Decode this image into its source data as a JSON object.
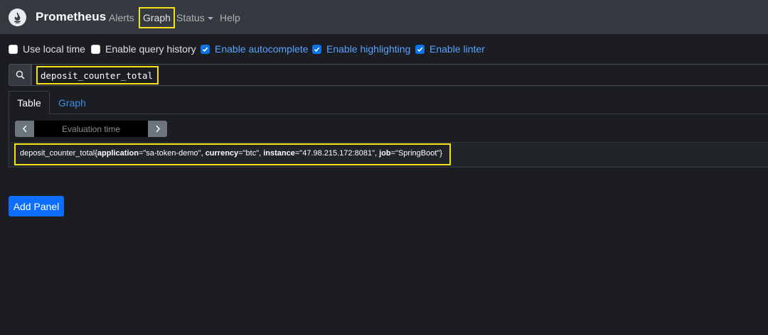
{
  "navbar": {
    "brand": "Prometheus",
    "links": {
      "alerts": "Alerts",
      "graph": "Graph",
      "status": "Status",
      "help": "Help"
    }
  },
  "options": {
    "local_time": {
      "label": "Use local time",
      "checked": false
    },
    "query_history": {
      "label": "Enable query history",
      "checked": false
    },
    "autocomplete": {
      "label": "Enable autocomplete",
      "checked": true
    },
    "highlighting": {
      "label": "Enable highlighting",
      "checked": true
    },
    "linter": {
      "label": "Enable linter",
      "checked": true
    }
  },
  "query": {
    "expression": "deposit_counter_total"
  },
  "panel": {
    "tabs": {
      "table": "Table",
      "graph": "Graph"
    },
    "active_tab": "Table",
    "evaluation_time_placeholder": "Evaluation time",
    "result": {
      "metric": "deposit_counter_total",
      "open": "{",
      "close": "}",
      "labels": [
        {
          "key": "application",
          "value": "\"sa-token-demo\"",
          "sep": ", "
        },
        {
          "key": "currency",
          "value": "\"btc\"",
          "sep": ", "
        },
        {
          "key": "instance",
          "value": "\"47.98.215.172:8081\"",
          "sep": ", "
        },
        {
          "key": "job",
          "value": "\"SpringBoot\"",
          "sep": ""
        }
      ]
    }
  },
  "add_panel_label": "Add Panel",
  "icons": {
    "logo": "prometheus-logo-icon",
    "search": "search-icon",
    "prev": "chevron-left-icon",
    "next": "chevron-right-icon",
    "caret": "caret-down-icon",
    "check": "check-icon"
  },
  "colors": {
    "navbar": "#343a40",
    "background": "#1b1d22",
    "accent": "#0d6efd",
    "link": "#3b8eea",
    "highlight": "#f5e215"
  }
}
